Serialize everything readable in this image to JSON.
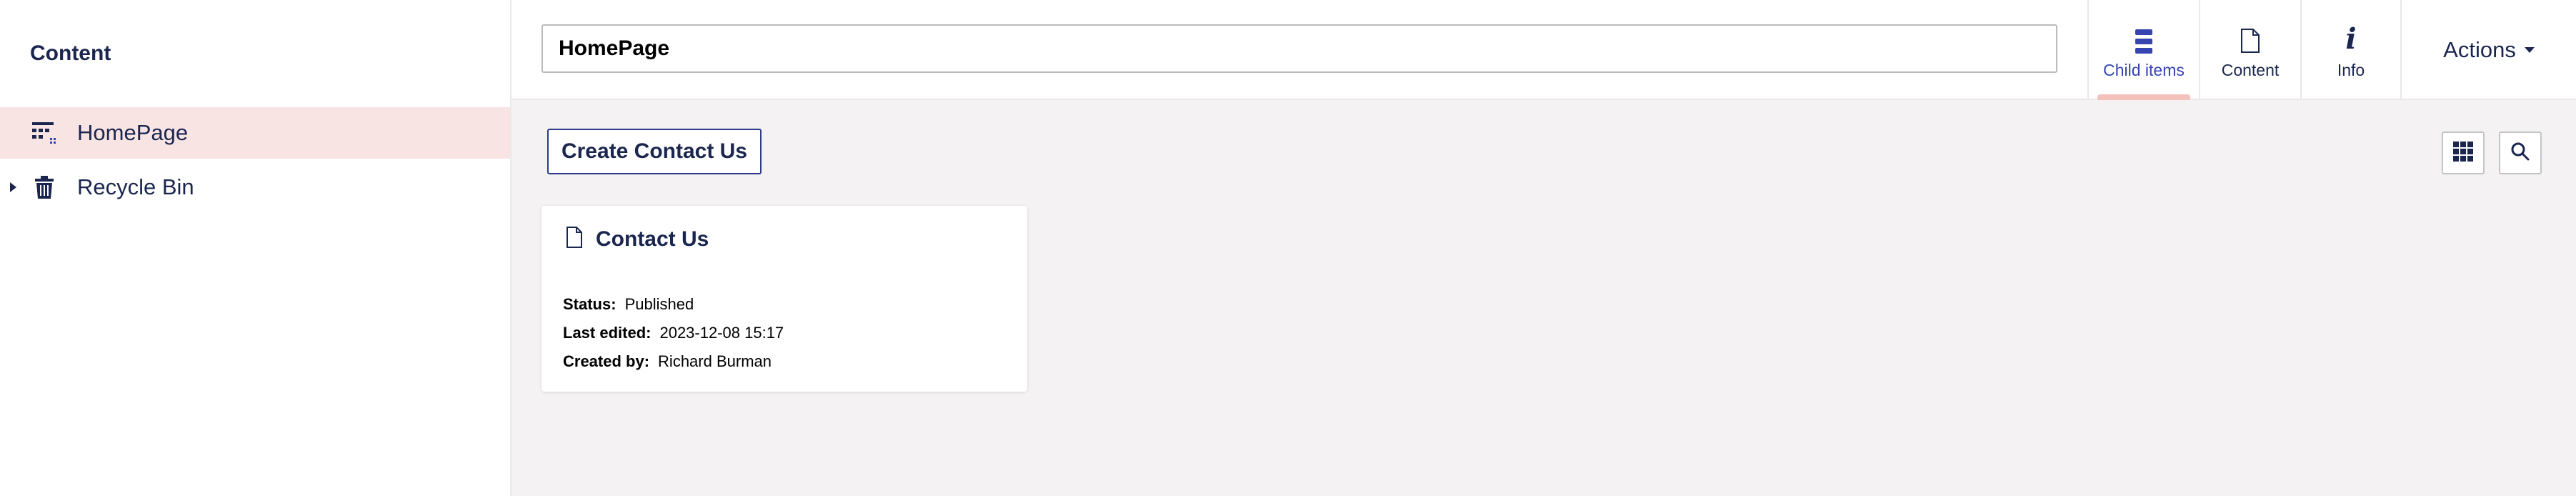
{
  "sidebar": {
    "header": "Content",
    "items": [
      {
        "label": "HomePage",
        "icon": "document-grid-icon",
        "active": true
      },
      {
        "label": "Recycle Bin",
        "icon": "trash-icon",
        "expandable": true
      }
    ]
  },
  "header": {
    "name_value": "HomePage",
    "apps": [
      {
        "label": "Child items",
        "icon": "list-icon",
        "active": true
      },
      {
        "label": "Content",
        "icon": "document-icon"
      },
      {
        "label": "Info",
        "icon": "info-icon"
      }
    ],
    "actions_label": "Actions"
  },
  "main": {
    "create_button": "Create Contact Us",
    "toolbar": {
      "grid_icon": "grid-view-icon",
      "search_icon": "search-icon"
    },
    "cards": [
      {
        "title": "Contact Us",
        "icon": "document-icon",
        "status_key": "Status:",
        "status_value": "Published",
        "last_edited_key": "Last edited:",
        "last_edited_value": "2023-12-08 15:17",
        "created_by_key": "Created by:",
        "created_by_value": "Richard Burman"
      }
    ]
  },
  "colors": {
    "primary": "#1b264f",
    "active_blue": "#3544b1",
    "active_row_bg": "#f9e4e4",
    "tab_indicator": "#f5c1bc",
    "workspace_bg": "#f4f2f2"
  }
}
